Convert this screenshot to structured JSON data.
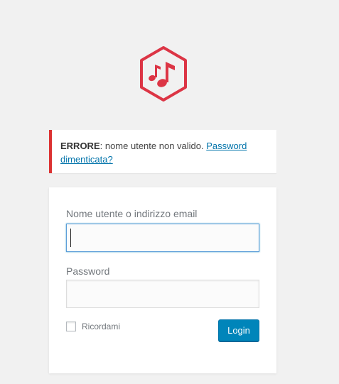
{
  "logo": {
    "icon": "music-note-hexagon-icon",
    "color": "#dc3545"
  },
  "error": {
    "strong": "ERRORE",
    "message": ": nome utente non valido. ",
    "link_text": "Password dimenticata?",
    "border_color": "#dc3232"
  },
  "form": {
    "username_label": "Nome utente o indirizzo email",
    "username_value": "",
    "password_label": "Password",
    "password_value": "",
    "remember_label": "Ricordami",
    "remember_checked": false,
    "submit_label": "Login"
  },
  "colors": {
    "background": "#f1f1f1",
    "primary_button": "#0085ba",
    "link": "#0073aa"
  }
}
